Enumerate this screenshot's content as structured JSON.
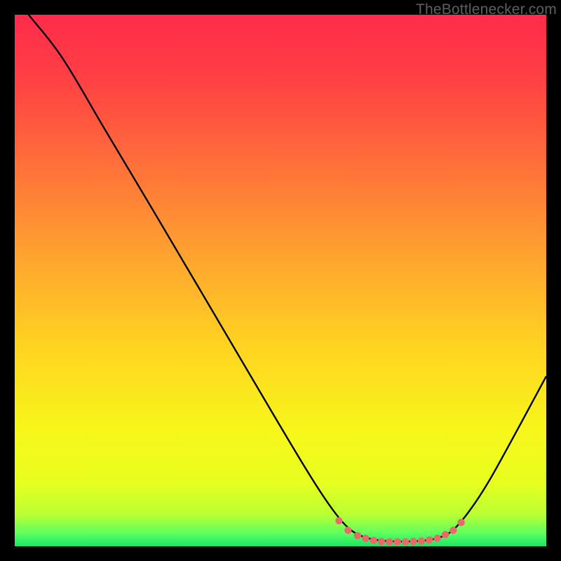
{
  "watermark": "TheBottlenecker.com",
  "chart_data": {
    "type": "line",
    "title": "",
    "xlabel": "",
    "ylabel": "",
    "xlim": [
      0,
      100
    ],
    "ylim": [
      0,
      100
    ],
    "background_gradient": {
      "stops": [
        {
          "offset": 0.0,
          "color": "#ff2b4a"
        },
        {
          "offset": 0.12,
          "color": "#ff4044"
        },
        {
          "offset": 0.28,
          "color": "#ff6f3a"
        },
        {
          "offset": 0.45,
          "color": "#ffa22f"
        },
        {
          "offset": 0.62,
          "color": "#ffd321"
        },
        {
          "offset": 0.78,
          "color": "#f7f61a"
        },
        {
          "offset": 0.88,
          "color": "#e8ff1f"
        },
        {
          "offset": 0.94,
          "color": "#baff33"
        },
        {
          "offset": 0.975,
          "color": "#60ff60"
        },
        {
          "offset": 1.0,
          "color": "#16e765"
        }
      ]
    },
    "curve": [
      {
        "x": 2.6,
        "y": 100.0
      },
      {
        "x": 8.0,
        "y": 93.5
      },
      {
        "x": 12.0,
        "y": 87.0
      },
      {
        "x": 16.0,
        "y": 80.0
      },
      {
        "x": 22.0,
        "y": 70.0
      },
      {
        "x": 30.0,
        "y": 56.5
      },
      {
        "x": 40.0,
        "y": 39.5
      },
      {
        "x": 50.0,
        "y": 22.5
      },
      {
        "x": 56.0,
        "y": 12.5
      },
      {
        "x": 60.0,
        "y": 6.5
      },
      {
        "x": 63.0,
        "y": 3.0
      },
      {
        "x": 66.0,
        "y": 1.5
      },
      {
        "x": 70.0,
        "y": 0.9
      },
      {
        "x": 76.0,
        "y": 0.9
      },
      {
        "x": 80.0,
        "y": 1.5
      },
      {
        "x": 83.0,
        "y": 3.2
      },
      {
        "x": 88.0,
        "y": 10.0
      },
      {
        "x": 93.0,
        "y": 19.0
      },
      {
        "x": 100.0,
        "y": 32.0
      }
    ],
    "highlight_dots": [
      {
        "x": 61.0,
        "y": 4.8
      },
      {
        "x": 62.7,
        "y": 3.0
      },
      {
        "x": 64.5,
        "y": 2.0
      },
      {
        "x": 66.0,
        "y": 1.5
      },
      {
        "x": 67.5,
        "y": 1.1
      },
      {
        "x": 69.0,
        "y": 0.9
      },
      {
        "x": 70.5,
        "y": 0.85
      },
      {
        "x": 72.0,
        "y": 0.85
      },
      {
        "x": 73.5,
        "y": 0.85
      },
      {
        "x": 75.0,
        "y": 0.9
      },
      {
        "x": 76.5,
        "y": 1.0
      },
      {
        "x": 78.0,
        "y": 1.2
      },
      {
        "x": 79.5,
        "y": 1.5
      },
      {
        "x": 81.0,
        "y": 2.2
      },
      {
        "x": 82.5,
        "y": 3.0
      },
      {
        "x": 84.0,
        "y": 4.5
      }
    ],
    "highlight_color": "#e86a6a",
    "curve_color": "#000000"
  }
}
